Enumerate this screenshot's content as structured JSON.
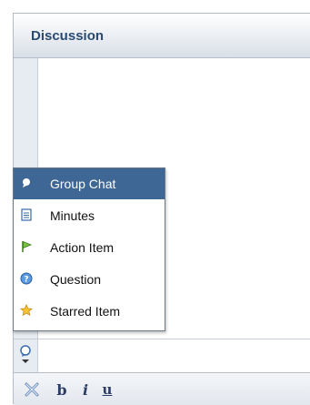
{
  "panel": {
    "title": "Discussion"
  },
  "menu": {
    "items": [
      {
        "label": "Group Chat",
        "icon": "chat-bubble-icon",
        "selected": true
      },
      {
        "label": "Minutes",
        "icon": "document-icon",
        "selected": false
      },
      {
        "label": "Action Item",
        "icon": "flag-icon",
        "selected": false
      },
      {
        "label": "Question",
        "icon": "question-icon",
        "selected": false
      },
      {
        "label": "Starred Item",
        "icon": "star-icon",
        "selected": false
      }
    ]
  },
  "toolbar": {
    "bold_label": "b",
    "italic_label": "i",
    "underline_label": "u"
  },
  "colors": {
    "selection": "#3f6796",
    "title": "#2a4a72"
  }
}
